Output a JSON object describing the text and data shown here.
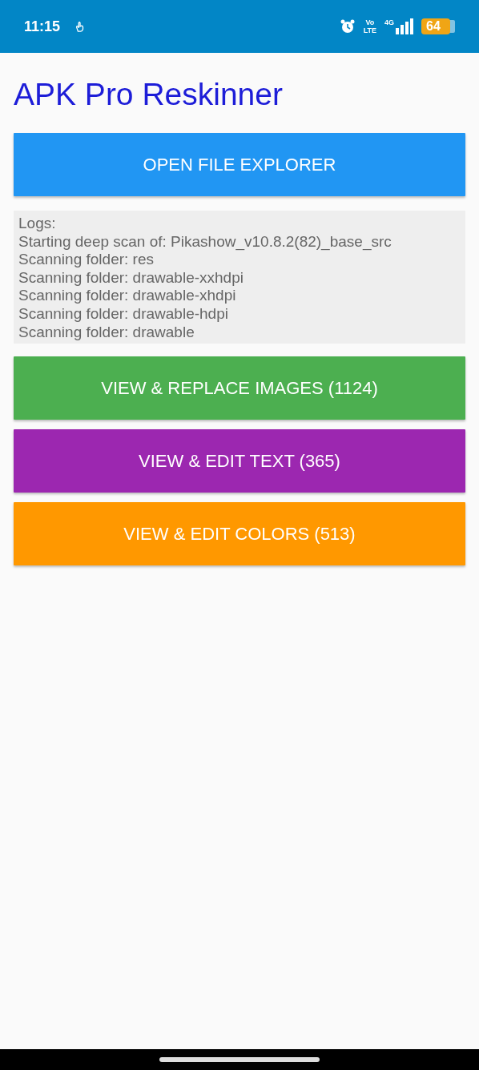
{
  "status_bar": {
    "time": "11:15",
    "network": "4G",
    "volte": [
      "Vo",
      "LTE"
    ],
    "battery": "64"
  },
  "app": {
    "title": "APK Pro Reskinner"
  },
  "primary_button": {
    "label": "OPEN FILE EXPLORER",
    "color": "#2196f3"
  },
  "logs": [
    "Logs:",
    "Starting deep scan of: Pikashow_v10.8.2(82)_base_src",
    "Scanning folder: res",
    "Scanning folder: drawable-xxhdpi",
    "Scanning folder: drawable-xhdpi",
    "Scanning folder: drawable-hdpi",
    "Scanning folder: drawable"
  ],
  "actions": [
    {
      "label": "VIEW & REPLACE IMAGES (1124)",
      "color": "#4caf50"
    },
    {
      "label": "VIEW & EDIT TEXT (365)",
      "color": "#9c27b0"
    },
    {
      "label": "VIEW & EDIT COLORS (513)",
      "color": "#ff9800"
    }
  ]
}
